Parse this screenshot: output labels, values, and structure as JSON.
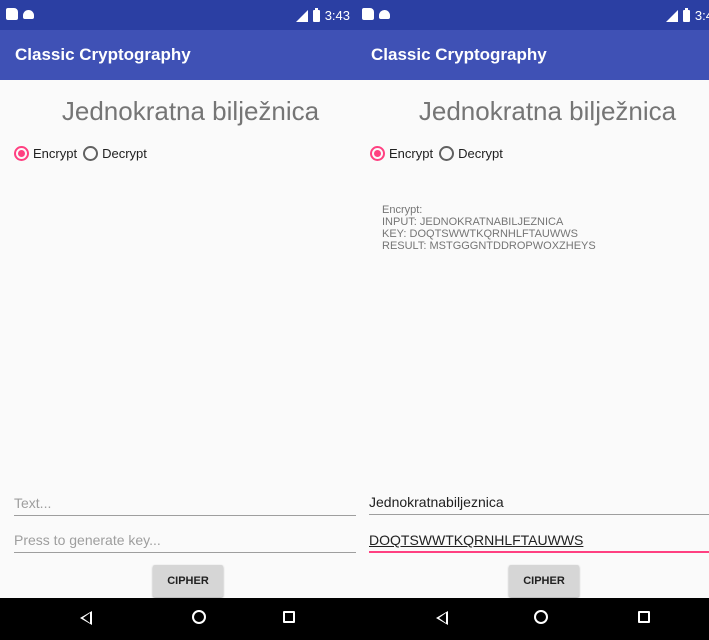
{
  "left_screen": {
    "status_time": "3:43",
    "app_title": "Classic Cryptography",
    "page_title": "Jednokratna bilježnica",
    "radio_encrypt": "Encrypt",
    "radio_decrypt": "Decrypt",
    "selected_mode": "Encrypt",
    "text_placeholder": "Text...",
    "key_placeholder": "Press to generate key...",
    "cipher_label": "CIPHER"
  },
  "right_screen": {
    "status_time": "3:4",
    "app_title": "Classic Cryptography",
    "page_title": "Jednokratna bilježnica",
    "radio_encrypt": "Encrypt",
    "radio_decrypt": "Decrypt",
    "selected_mode": "Encrypt",
    "result_lines": [
      "Encrypt:",
      "INPUT: JEDNOKRATNABILJEZNICA",
      "KEY: DOQTSWWTKQRNHLFTAUWWS",
      "RESULT: MSTGGGNTDDROPWOXZHEYS"
    ],
    "text_value": "Jednokratnabiljeznica",
    "key_value": "DOQTSWWTKQRNHLFTAUWWS",
    "cipher_label": "CIPHER"
  },
  "colors": {
    "status_bar": "#2b3fa3",
    "app_bar": "#3f51b5",
    "accent": "#ff4081"
  },
  "icons": {
    "status_left": [
      "sd-card-icon",
      "android-debug-icon"
    ],
    "status_right": [
      "lte-signal-icon",
      "battery-icon"
    ],
    "nav": [
      "back-icon",
      "home-icon",
      "recents-icon"
    ]
  }
}
